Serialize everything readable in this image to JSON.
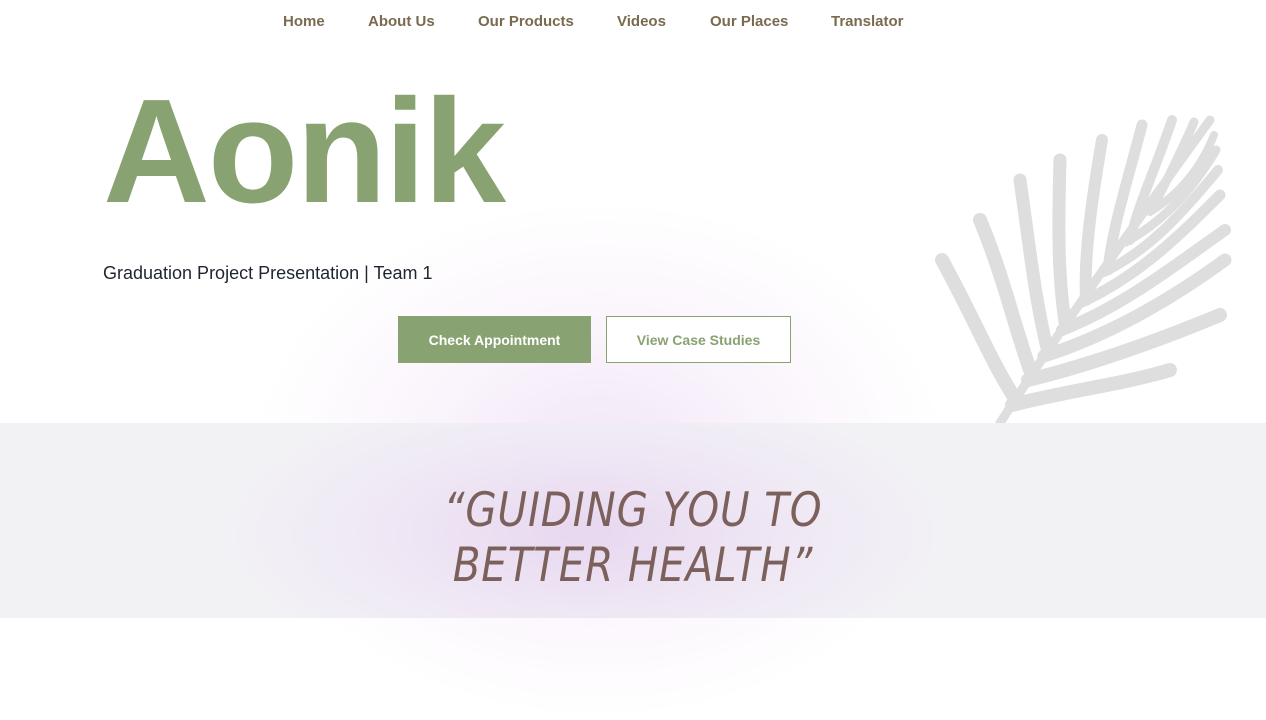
{
  "nav": {
    "items": [
      {
        "label": "Home"
      },
      {
        "label": "About Us"
      },
      {
        "label": "Our Products"
      },
      {
        "label": "Videos"
      },
      {
        "label": "Our Places"
      },
      {
        "label": "Translator"
      }
    ]
  },
  "hero": {
    "brand": "Aonik",
    "subtitle": "Graduation Project Presentation | Team 1",
    "primary_button": "Check Appointment",
    "secondary_button": "View Case Studies",
    "decoration": "palm-leaf-icon"
  },
  "quote": {
    "line1": "“GUIDING YOU TO",
    "line2": "BETTER HEALTH”"
  },
  "colors": {
    "accent": "#89a272",
    "nav_text": "#7a6a4f",
    "quote_text": "#7c605c",
    "section_bg": "#f2f2f5"
  }
}
